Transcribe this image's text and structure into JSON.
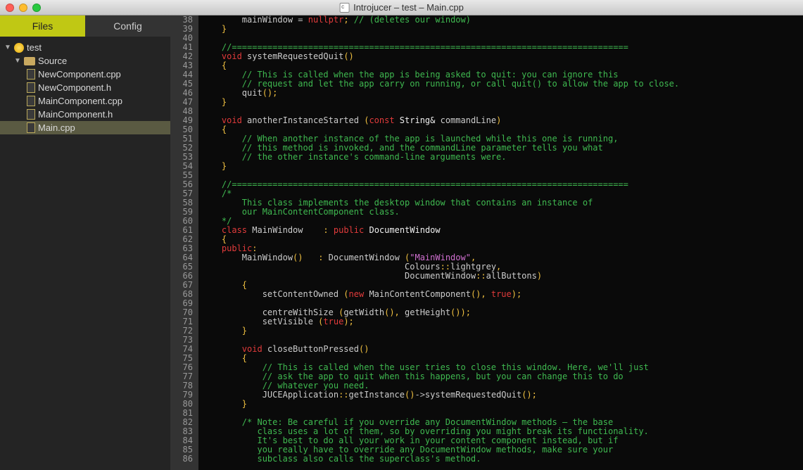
{
  "window": {
    "title": "Introjucer – test – Main.cpp"
  },
  "tabs": {
    "files": "Files",
    "config": "Config"
  },
  "tree": {
    "project": "test",
    "group": "Source",
    "files": [
      "NewComponent.cpp",
      "NewComponent.h",
      "MainComponent.cpp",
      "MainComponent.h",
      "Main.cpp"
    ]
  },
  "code": {
    "first_line": 38,
    "lines": [
      {
        "n": 38,
        "t": [
          [
            "",
            "        mainWindow "
          ],
          [
            "op",
            "="
          ],
          [
            "",
            " "
          ],
          [
            "kw",
            "nullptr"
          ],
          [
            "pn",
            ";"
          ],
          [
            "",
            " "
          ],
          [
            "cm",
            "// (deletes our window)"
          ]
        ]
      },
      {
        "n": 39,
        "t": [
          [
            "pn",
            "    }"
          ]
        ]
      },
      {
        "n": 40,
        "t": [
          [
            "",
            ""
          ]
        ]
      },
      {
        "n": 41,
        "t": [
          [
            "",
            "    "
          ],
          [
            "cm",
            "//=============================================================================="
          ]
        ]
      },
      {
        "n": 42,
        "t": [
          [
            "",
            "    "
          ],
          [
            "kw",
            "void"
          ],
          [
            "",
            " systemRequestedQuit"
          ],
          [
            "pn",
            "()"
          ]
        ]
      },
      {
        "n": 43,
        "t": [
          [
            "",
            "    "
          ],
          [
            "pn",
            "{"
          ]
        ]
      },
      {
        "n": 44,
        "t": [
          [
            "",
            "        "
          ],
          [
            "cm",
            "// This is called when the app is being asked to quit: you can ignore this"
          ]
        ]
      },
      {
        "n": 45,
        "t": [
          [
            "",
            "        "
          ],
          [
            "cm",
            "// request and let the app carry on running, or call quit() to allow the app to close."
          ]
        ]
      },
      {
        "n": 46,
        "t": [
          [
            "",
            "        quit"
          ],
          [
            "pn",
            "();"
          ]
        ]
      },
      {
        "n": 47,
        "t": [
          [
            "",
            "    "
          ],
          [
            "pn",
            "}"
          ]
        ]
      },
      {
        "n": 48,
        "t": [
          [
            "",
            ""
          ]
        ]
      },
      {
        "n": 49,
        "t": [
          [
            "",
            "    "
          ],
          [
            "kw",
            "void"
          ],
          [
            "",
            " anotherInstanceStarted "
          ],
          [
            "pn",
            "("
          ],
          [
            "kw",
            "const"
          ],
          [
            "",
            " "
          ],
          [
            "ty",
            "String&"
          ],
          [
            "",
            " commandLine"
          ],
          [
            "pn",
            ")"
          ]
        ]
      },
      {
        "n": 50,
        "t": [
          [
            "",
            "    "
          ],
          [
            "pn",
            "{"
          ]
        ]
      },
      {
        "n": 51,
        "t": [
          [
            "",
            "        "
          ],
          [
            "cm",
            "// When another instance of the app is launched while this one is running,"
          ]
        ]
      },
      {
        "n": 52,
        "t": [
          [
            "",
            "        "
          ],
          [
            "cm",
            "// this method is invoked, and the commandLine parameter tells you what"
          ]
        ]
      },
      {
        "n": 53,
        "t": [
          [
            "",
            "        "
          ],
          [
            "cm",
            "// the other instance's command-line arguments were."
          ]
        ]
      },
      {
        "n": 54,
        "t": [
          [
            "",
            "    "
          ],
          [
            "pn",
            "}"
          ]
        ]
      },
      {
        "n": 55,
        "t": [
          [
            "",
            ""
          ]
        ]
      },
      {
        "n": 56,
        "t": [
          [
            "",
            "    "
          ],
          [
            "cm",
            "//=============================================================================="
          ]
        ]
      },
      {
        "n": 57,
        "t": [
          [
            "",
            "    "
          ],
          [
            "cm",
            "/*"
          ]
        ]
      },
      {
        "n": 58,
        "t": [
          [
            "",
            "        "
          ],
          [
            "cm",
            "This class implements the desktop window that contains an instance of"
          ]
        ]
      },
      {
        "n": 59,
        "t": [
          [
            "",
            "        "
          ],
          [
            "cm",
            "our MainContentComponent class."
          ]
        ]
      },
      {
        "n": 60,
        "t": [
          [
            "",
            "    "
          ],
          [
            "cm",
            "*/"
          ]
        ]
      },
      {
        "n": 61,
        "t": [
          [
            "",
            "    "
          ],
          [
            "kw",
            "class"
          ],
          [
            "",
            " MainWindow    "
          ],
          [
            "pn",
            ":"
          ],
          [
            "",
            " "
          ],
          [
            "kw",
            "public"
          ],
          [
            "",
            " "
          ],
          [
            "ty",
            "DocumentWindow"
          ]
        ]
      },
      {
        "n": 62,
        "t": [
          [
            "",
            "    "
          ],
          [
            "pn",
            "{"
          ]
        ]
      },
      {
        "n": 63,
        "t": [
          [
            "",
            "    "
          ],
          [
            "kw",
            "public"
          ],
          [
            "pn",
            ":"
          ]
        ]
      },
      {
        "n": 64,
        "t": [
          [
            "",
            "        MainWindow"
          ],
          [
            "pn",
            "()"
          ],
          [
            "",
            "   "
          ],
          [
            "pn",
            ":"
          ],
          [
            "",
            " DocumentWindow "
          ],
          [
            "pn",
            "("
          ],
          [
            "str",
            "\"MainWindow\""
          ],
          [
            "pn",
            ","
          ]
        ]
      },
      {
        "n": 65,
        "t": [
          [
            "",
            "                                        Colours"
          ],
          [
            "pn",
            "::"
          ],
          [
            "",
            "lightgrey"
          ],
          [
            "pn",
            ","
          ]
        ]
      },
      {
        "n": 66,
        "t": [
          [
            "",
            "                                        DocumentWindow"
          ],
          [
            "pn",
            "::"
          ],
          [
            "",
            "allButtons"
          ],
          [
            "pn",
            ")"
          ]
        ]
      },
      {
        "n": 67,
        "t": [
          [
            "",
            "        "
          ],
          [
            "pn",
            "{"
          ]
        ]
      },
      {
        "n": 68,
        "t": [
          [
            "",
            "            setContentOwned "
          ],
          [
            "pn",
            "("
          ],
          [
            "kw",
            "new"
          ],
          [
            "",
            " MainContentComponent"
          ],
          [
            "pn",
            "(),"
          ],
          [
            "",
            " "
          ],
          [
            "kw",
            "true"
          ],
          [
            "pn",
            ");"
          ]
        ]
      },
      {
        "n": 69,
        "t": [
          [
            "",
            ""
          ]
        ]
      },
      {
        "n": 70,
        "t": [
          [
            "",
            "            centreWithSize "
          ],
          [
            "pn",
            "("
          ],
          [
            "",
            "getWidth"
          ],
          [
            "pn",
            "(),"
          ],
          [
            "",
            " getHeight"
          ],
          [
            "pn",
            "());"
          ]
        ]
      },
      {
        "n": 71,
        "t": [
          [
            "",
            "            setVisible "
          ],
          [
            "pn",
            "("
          ],
          [
            "kw",
            "true"
          ],
          [
            "pn",
            ");"
          ]
        ]
      },
      {
        "n": 72,
        "t": [
          [
            "",
            "        "
          ],
          [
            "pn",
            "}"
          ]
        ]
      },
      {
        "n": 73,
        "t": [
          [
            "",
            ""
          ]
        ]
      },
      {
        "n": 74,
        "t": [
          [
            "",
            "        "
          ],
          [
            "kw",
            "void"
          ],
          [
            "",
            " closeButtonPressed"
          ],
          [
            "pn",
            "()"
          ]
        ]
      },
      {
        "n": 75,
        "t": [
          [
            "",
            "        "
          ],
          [
            "pn",
            "{"
          ]
        ]
      },
      {
        "n": 76,
        "t": [
          [
            "",
            "            "
          ],
          [
            "cm",
            "// This is called when the user tries to close this window. Here, we'll just"
          ]
        ]
      },
      {
        "n": 77,
        "t": [
          [
            "",
            "            "
          ],
          [
            "cm",
            "// ask the app to quit when this happens, but you can change this to do"
          ]
        ]
      },
      {
        "n": 78,
        "t": [
          [
            "",
            "            "
          ],
          [
            "cm",
            "// whatever you need."
          ]
        ]
      },
      {
        "n": 79,
        "t": [
          [
            "",
            "            JUCEApplication"
          ],
          [
            "pn",
            "::"
          ],
          [
            "",
            "getInstance"
          ],
          [
            "pn",
            "()"
          ],
          [
            "op",
            "->"
          ],
          [
            "",
            "systemRequestedQuit"
          ],
          [
            "pn",
            "();"
          ]
        ]
      },
      {
        "n": 80,
        "t": [
          [
            "",
            "        "
          ],
          [
            "pn",
            "}"
          ]
        ]
      },
      {
        "n": 81,
        "t": [
          [
            "",
            ""
          ]
        ]
      },
      {
        "n": 82,
        "t": [
          [
            "",
            "        "
          ],
          [
            "cm",
            "/* Note: Be careful if you override any DocumentWindow methods – the base"
          ]
        ]
      },
      {
        "n": 83,
        "t": [
          [
            "",
            "           "
          ],
          [
            "cm",
            "class uses a lot of them, so by overriding you might break its functionality."
          ]
        ]
      },
      {
        "n": 84,
        "t": [
          [
            "",
            "           "
          ],
          [
            "cm",
            "It's best to do all your work in your content component instead, but if"
          ]
        ]
      },
      {
        "n": 85,
        "t": [
          [
            "",
            "           "
          ],
          [
            "cm",
            "you really have to override any DocumentWindow methods, make sure your"
          ]
        ]
      },
      {
        "n": 86,
        "t": [
          [
            "",
            "           "
          ],
          [
            "cm",
            "subclass also calls the superclass's method."
          ]
        ]
      }
    ]
  }
}
